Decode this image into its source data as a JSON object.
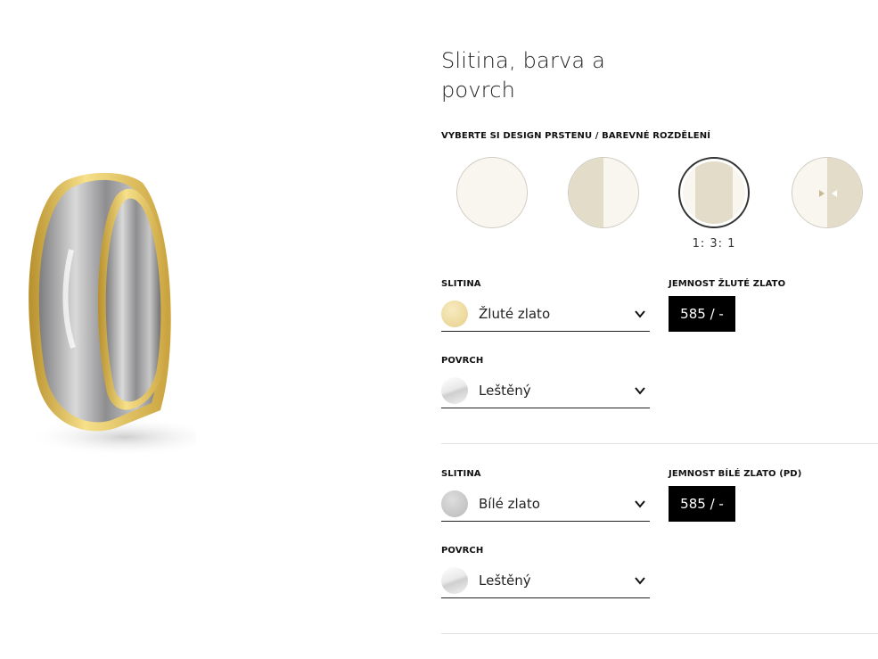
{
  "section": {
    "title": "Slitina, barva a povrch",
    "design_heading": "VYBERTE SI DESIGN PRSTENU / BAREVNÉ ROZDĚLENÍ",
    "designs": [
      {
        "id": "solid",
        "label": ""
      },
      {
        "id": "half",
        "label": ""
      },
      {
        "id": "three-part",
        "label": "1: 3: 1",
        "selected": true
      },
      {
        "id": "custom-split",
        "label": ""
      }
    ]
  },
  "metal1": {
    "alloy_label": "SLITINA",
    "alloy_value": "Žluté zlato",
    "fineness_label": "JEMNOST ŽLUTÉ ZLATO",
    "fineness_value": "585 / -",
    "surface_label": "POVRCH",
    "surface_value": "Leštěný"
  },
  "metal2": {
    "alloy_label": "SLITINA",
    "alloy_value": "Bílé zlato",
    "fineness_label": "JEMNOST BÍLÉ ZLATO (PD)",
    "fineness_value": "585 / -",
    "surface_label": "POVRCH",
    "surface_value": "Leštěný"
  },
  "colors": {
    "cream": "#f8f6ef",
    "beige": "#e2dcc8",
    "yellow_gold": "#ecd69a",
    "white_gold": "#c4c4c4",
    "fineness_bg": "#000000"
  }
}
